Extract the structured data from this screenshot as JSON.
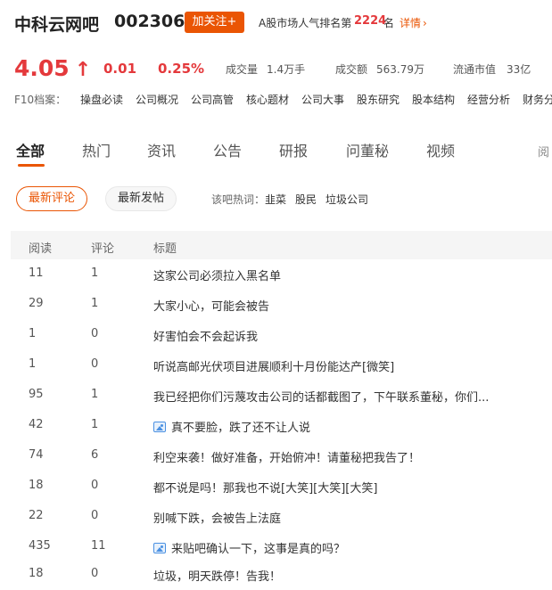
{
  "header": {
    "stock_name": "中科云网吧",
    "stock_code": "002306",
    "follow_label": "加关注+",
    "rank_label": "A股市场人气排名第",
    "rank_value": "2224",
    "rank_unit": "名",
    "detail_label": "详情"
  },
  "quote": {
    "price": "4.05",
    "change": "0.01",
    "change_pct": "0.25%",
    "volume_label": "成交量",
    "volume_value": "1.4万手",
    "amount_label": "成交额",
    "amount_value": "563.79万",
    "float_cap_label": "流通市值",
    "float_cap_value": "33亿",
    "color_up": "#e4393c"
  },
  "f10": {
    "label": "F10档案：",
    "items": [
      "操盘必读",
      "公司概况",
      "公司高管",
      "核心题材",
      "公司大事",
      "股东研究",
      "股本结构",
      "经营分析",
      "财务分"
    ]
  },
  "tabs": [
    "全部",
    "热门",
    "资讯",
    "公告",
    "研报",
    "问董秘",
    "视频",
    "阅"
  ],
  "filters": {
    "latest_comment": "最新评论",
    "latest_post": "最新发帖",
    "hot_label": "该吧热词：",
    "hot_words": [
      "韭菜",
      "股民",
      "垃圾公司"
    ]
  },
  "table": {
    "headers": [
      "阅读",
      "评论",
      "标题"
    ],
    "rows": [
      {
        "reads": "11",
        "comments": "1",
        "title": "这家公司必须拉入黑名单",
        "icon": ""
      },
      {
        "reads": "29",
        "comments": "1",
        "title": "大家小心，可能会被告",
        "icon": ""
      },
      {
        "reads": "1",
        "comments": "0",
        "title": "好害怕会不会起诉我",
        "icon": ""
      },
      {
        "reads": "1",
        "comments": "0",
        "title": "听说高邮光伏项目进展顺利十月份能达产[微笑]",
        "icon": ""
      },
      {
        "reads": "95",
        "comments": "1",
        "title": "我已经把你们污蔑攻击公司的话都截图了，下午联系董秘，你们...",
        "icon": ""
      },
      {
        "reads": "42",
        "comments": "1",
        "title": "真不要脸，跌了还不让人说",
        "icon": "image-icon"
      },
      {
        "reads": "74",
        "comments": "6",
        "title": "利空来袭！做好准备，开始俯冲！请董秘把我告了！",
        "icon": ""
      },
      {
        "reads": "18",
        "comments": "0",
        "title": "都不说是吗！那我也不说[大笑][大笑][大笑]",
        "icon": ""
      },
      {
        "reads": "22",
        "comments": "0",
        "title": "别喊下跌，会被告上法庭",
        "icon": ""
      },
      {
        "reads": "435",
        "comments": "11",
        "title": "来贴吧确认一下，这事是真的吗？",
        "icon": "image-icon"
      },
      {
        "reads": "18",
        "comments": "0",
        "title": "垃圾，明天跌停！告我！",
        "icon": ""
      }
    ]
  },
  "colors": {
    "accent": "#ea5504",
    "up": "#e4393c"
  }
}
